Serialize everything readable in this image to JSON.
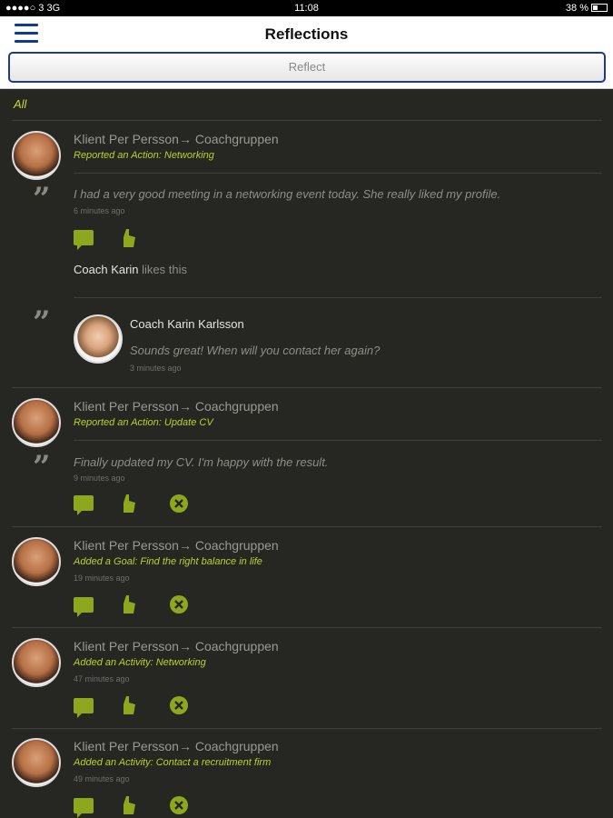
{
  "status_bar": {
    "carrier": "●●●●○ 3  3G",
    "time": "11:08",
    "battery": "38 %"
  },
  "header": {
    "title": "Reflections",
    "reflect_button": "Reflect"
  },
  "filter": "All",
  "feed": [
    {
      "author": "Klient Per Persson→ Coachgruppen",
      "action": "Reported an Action: Networking",
      "message": "I had a very good meeting in a networking event today. She really liked my profile.",
      "time": "6 minutes ago",
      "likes": {
        "name": "Coach Karin",
        "text": " likes this"
      },
      "comment": {
        "author": "Coach Karin Karlsson",
        "message": "Sounds great! When will you contact her again?",
        "time": "3 minutes ago"
      }
    },
    {
      "author": "Klient Per Persson→ Coachgruppen",
      "action": "Reported an Action: Update CV",
      "message": "Finally updated my CV. I'm happy with the result.",
      "time": "9 minutes ago"
    },
    {
      "author": "Klient Per Persson→ Coachgruppen",
      "action": "Added a Goal: Find the right balance in life",
      "time": "19 minutes ago"
    },
    {
      "author": "Klient Per Persson→ Coachgruppen",
      "action": "Added an Activity: Networking",
      "time": "47 minutes ago"
    },
    {
      "author": "Klient Per Persson→ Coachgruppen",
      "action": "Added an Activity: Contact a recruitment firm",
      "time": "49 minutes ago"
    }
  ],
  "colors": {
    "accent": "#b9d22a",
    "icon": "#8ea81d",
    "nav": "#1f3b8f",
    "background": "#262622"
  }
}
